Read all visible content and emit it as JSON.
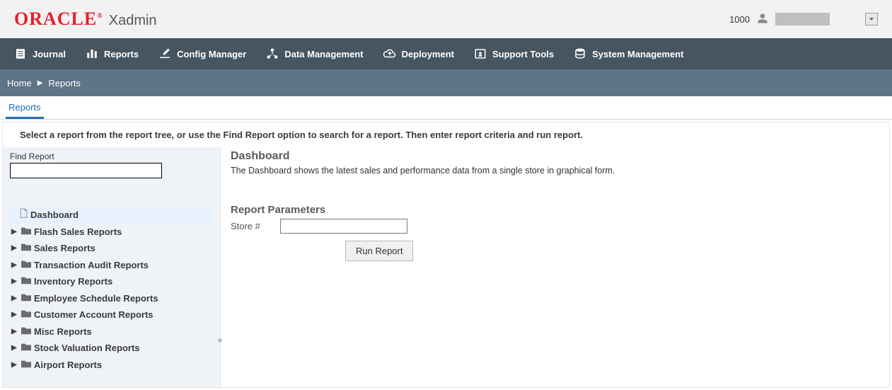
{
  "header": {
    "logo_text": "ORACLE",
    "app_name": "Xadmin",
    "user_id": "1000"
  },
  "nav": [
    {
      "icon": "journal-icon",
      "label": "Journal"
    },
    {
      "icon": "reports-icon",
      "label": "Reports"
    },
    {
      "icon": "config-icon",
      "label": "Config Manager"
    },
    {
      "icon": "data-mgmt-icon",
      "label": "Data Management"
    },
    {
      "icon": "deploy-icon",
      "label": "Deployment"
    },
    {
      "icon": "support-icon",
      "label": "Support Tools"
    },
    {
      "icon": "system-mgmt-icon",
      "label": "System Management"
    }
  ],
  "breadcrumb": [
    "Home",
    "Reports"
  ],
  "tab_label": "Reports",
  "instruction": "Select a report from the report tree, or use the Find Report option to search for a report. Then enter report criteria and run report.",
  "sidebar": {
    "find_label": "Find Report",
    "find_value": "",
    "tree": [
      {
        "type": "leaf",
        "label": "Dashboard",
        "selected": true
      },
      {
        "type": "folder",
        "label": "Flash Sales Reports"
      },
      {
        "type": "folder",
        "label": "Sales Reports"
      },
      {
        "type": "folder",
        "label": "Transaction Audit Reports"
      },
      {
        "type": "folder",
        "label": "Inventory Reports"
      },
      {
        "type": "folder",
        "label": "Employee Schedule Reports"
      },
      {
        "type": "folder",
        "label": "Customer Account Reports"
      },
      {
        "type": "folder",
        "label": "Misc Reports"
      },
      {
        "type": "folder",
        "label": "Stock Valuation Reports"
      },
      {
        "type": "folder",
        "label": "Airport Reports"
      }
    ]
  },
  "detail": {
    "title": "Dashboard",
    "description": "The Dashboard shows the latest sales and performance data from a single store in graphical form.",
    "params_heading": "Report Parameters",
    "param_label": "Store #",
    "param_value": "",
    "run_label": "Run Report"
  }
}
